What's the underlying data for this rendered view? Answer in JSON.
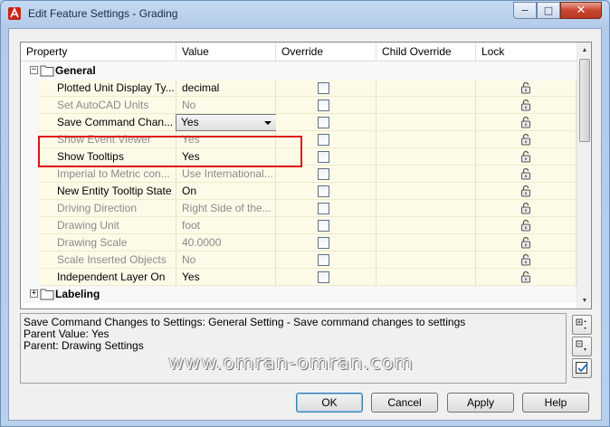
{
  "window": {
    "title": "Edit Feature Settings - Grading",
    "controls": {
      "minimize": "−",
      "maximize": "□",
      "close": "✕"
    }
  },
  "grid": {
    "columns": [
      "Property",
      "Value",
      "Override",
      "Child Override",
      "Lock"
    ],
    "categories": [
      {
        "label": "General",
        "expanded": true,
        "expander": "−"
      },
      {
        "label": "Labeling",
        "expanded": false,
        "expander": "+"
      }
    ],
    "rows": [
      {
        "property": "Plotted Unit Display Ty...",
        "value": "decimal",
        "enabled": true
      },
      {
        "property": "Set AutoCAD Units",
        "value": "No",
        "enabled": false
      },
      {
        "property": "Save Command Chan...",
        "value": "Yes",
        "enabled": true,
        "editing": true
      },
      {
        "property": "Show Event Viewer",
        "value": "Yes",
        "enabled": false
      },
      {
        "property": "Show Tooltips",
        "value": "Yes",
        "enabled": true
      },
      {
        "property": "Imperial to Metric con...",
        "value": "Use International...",
        "enabled": false
      },
      {
        "property": "New Entity Tooltip State",
        "value": "On",
        "enabled": true
      },
      {
        "property": "Driving Direction",
        "value": "Right Side of the...",
        "enabled": false
      },
      {
        "property": "Drawing Unit",
        "value": "foot",
        "enabled": false
      },
      {
        "property": "Drawing Scale",
        "value": "40.0000",
        "enabled": false
      },
      {
        "property": "Scale Inserted Objects",
        "value": "No",
        "enabled": false
      },
      {
        "property": "Independent Layer On",
        "value": "Yes",
        "enabled": true
      }
    ]
  },
  "description": {
    "line1": "Save Command Changes to Settings: General Setting - Save command changes to settings",
    "line2": "Parent Value: Yes",
    "line3": "Parent: Drawing Settings"
  },
  "watermark": "www.omran-omran.com",
  "buttons": {
    "ok": "OK",
    "cancel": "Cancel",
    "apply": "Apply",
    "help": "Help"
  },
  "colors": {
    "highlight": "#e0141a",
    "row_background": "#fdfbe8"
  }
}
